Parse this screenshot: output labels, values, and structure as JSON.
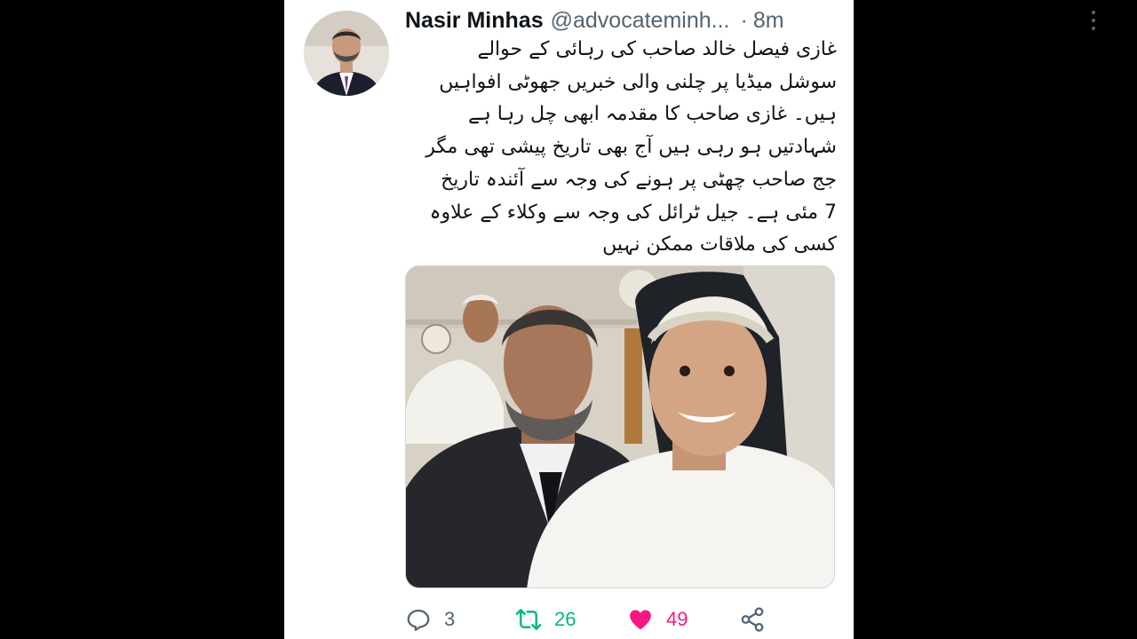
{
  "tweet": {
    "author": {
      "display_name": "Nasir Minhas",
      "handle": "@advocateminh...",
      "avatar_icon": "user-avatar"
    },
    "separator": "·",
    "time": "8m",
    "more_icon": "more-vertical-icon",
    "text_lines": [
      "غازی فیصل خالد صاحب کی رہائی کے حوالے",
      "سوشل میڈیا پر چلنی والی خبریں جھوٹی افواہیں",
      "ہیں۔ غازی صاحب کا مقدمہ ابھی چل رہا ہے",
      "شہادتیں ہو رہی ہیں آج بھی تاریخ پیشی تھی مگر",
      "جج صاحب چھٹی پر ہونے کی وجہ سے آئندہ تاریخ",
      "7 مئی ہے۔ جیل ٹرائل کی وجہ سے وکلاء کے علاوہ",
      "کسی کی ملاقات ممکن نہیں"
    ],
    "media": {
      "kind": "photo"
    },
    "actions": {
      "reply": {
        "icon": "reply-icon",
        "count": "3"
      },
      "retweet": {
        "icon": "retweet-icon",
        "count": "26"
      },
      "like": {
        "icon": "heart-icon",
        "count": "49"
      },
      "share": {
        "icon": "share-icon"
      }
    }
  },
  "colors": {
    "text_primary": "#0f1419",
    "text_secondary": "#536471",
    "retweet_active": "#00ba7c",
    "like_active": "#f91880",
    "background": "#ffffff",
    "letterbox": "#000000"
  }
}
